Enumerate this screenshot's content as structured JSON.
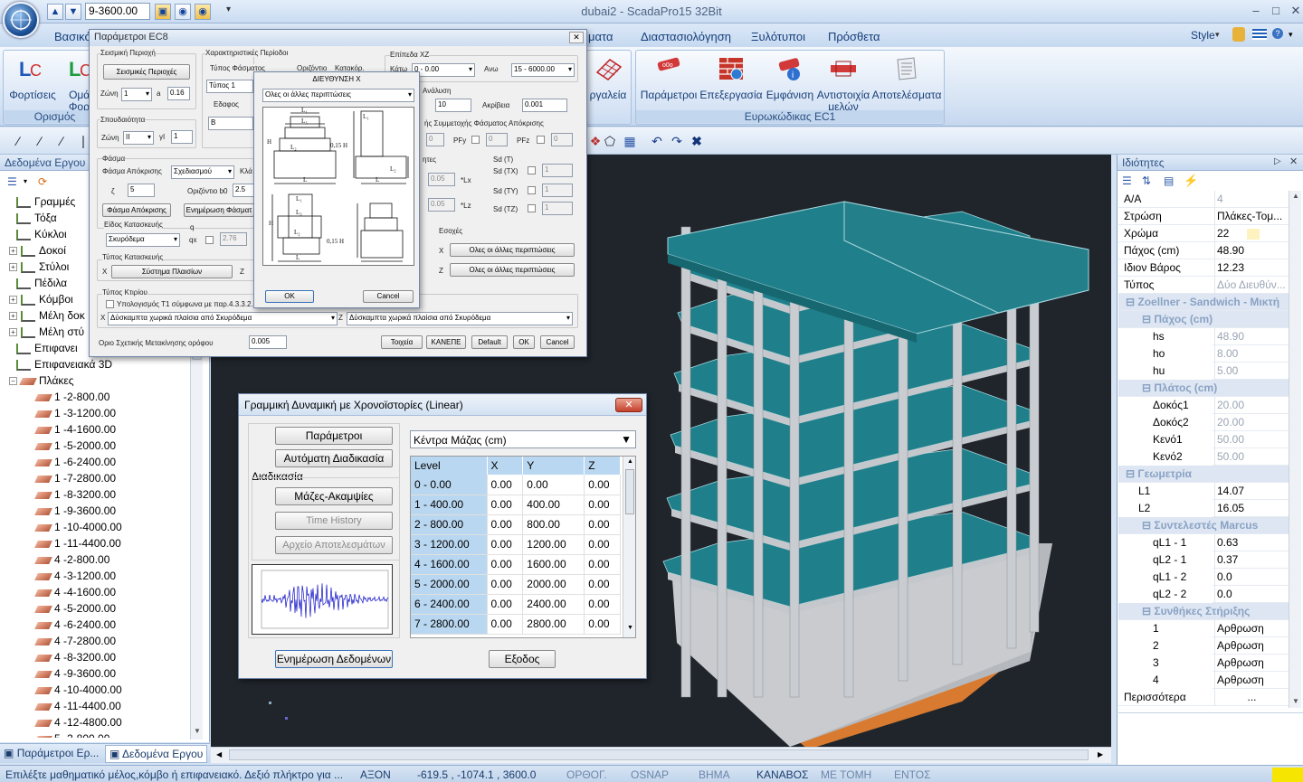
{
  "app": {
    "title": "dubai2 - ScadaPro15 32Bit",
    "level_select": "9-3600.00"
  },
  "menu_tabs": [
    "Βασικό",
    "ματα",
    "Διαστασιολόγηση",
    "Ξυλότυποι",
    "Πρόσθετα"
  ],
  "style_label": "Style",
  "ribbon": {
    "left_group": {
      "label": "Ορισμός",
      "buttons": [
        "Φορτίσεις",
        "Ομάδ Φορτί"
      ]
    },
    "tools_label": "ργαλεία",
    "ec1_group": {
      "label": "Ευρωκώδικας EC1",
      "buttons": [
        "Παράμετροι",
        "Επεξεργασία",
        "Εμφάνιση",
        "Αντιστοιχία μελών",
        "Αποτελέσματα"
      ]
    }
  },
  "left_panel": {
    "title": "Δεδομένα Εργου",
    "tree": [
      "Γραμμές",
      "Τόξα",
      "Κύκλοι",
      "Δοκοί",
      "Στύλοι",
      "Πέδιλα",
      "Κόμβοι",
      "Μέλη δοκ",
      "Μέλη στύ",
      "Επιφανει",
      "Επιφανειακά 3D",
      "Πλάκες",
      "1 -2-800.00",
      "1 -3-1200.00",
      "1 -4-1600.00",
      "1 -5-2000.00",
      "1 -6-2400.00",
      "1 -7-2800.00",
      "1 -8-3200.00",
      "1 -9-3600.00",
      "1 -10-4000.00",
      "1 -11-4400.00",
      "4 -2-800.00",
      "4 -3-1200.00",
      "4 -4-1600.00",
      "4 -5-2000.00",
      "4 -6-2400.00",
      "4 -7-2800.00",
      "4 -8-3200.00",
      "4 -9-3600.00",
      "4 -10-4000.00",
      "4 -11-4400.00",
      "4 -12-4800.00",
      "5 -2-800.00"
    ],
    "bottom_tabs": [
      "Παράμετροι Ερ...",
      "Δεδομένα Εργου"
    ]
  },
  "properties": {
    "title": "Ιδιότητες",
    "rows": [
      {
        "k": "A/A",
        "v": "4",
        "dis": true
      },
      {
        "k": "Στρώση",
        "v": "Πλάκες-Τομ..."
      },
      {
        "k": "Χρώμα",
        "v": "22"
      },
      {
        "k": "Πάχος (cm)",
        "v": "48.90"
      },
      {
        "k": "Ιδιον Βάρος",
        "v": "12.23"
      },
      {
        "k": "Τύπος",
        "v": "Δύο Διευθύν...",
        "dis": true
      },
      {
        "cat": "Zoellner - Sandwich - Μικτή"
      },
      {
        "sub": "Πάχος (cm)"
      },
      {
        "k": "hs",
        "v": "48.90",
        "ind": 2,
        "dis": true
      },
      {
        "k": "ho",
        "v": "8.00",
        "ind": 2,
        "dis": true
      },
      {
        "k": "hu",
        "v": "5.00",
        "ind": 2,
        "dis": true
      },
      {
        "sub": "Πλάτος (cm)"
      },
      {
        "k": "Δοκός1",
        "v": "20.00",
        "ind": 2,
        "dis": true
      },
      {
        "k": "Δοκός2",
        "v": "20.00",
        "ind": 2,
        "dis": true
      },
      {
        "k": "Κενό1",
        "v": "50.00",
        "ind": 2,
        "dis": true
      },
      {
        "k": "Κενό2",
        "v": "50.00",
        "ind": 2,
        "dis": true
      },
      {
        "cat": "Γεωμετρία"
      },
      {
        "k": "L1",
        "v": "14.07",
        "ind": 1
      },
      {
        "k": "L2",
        "v": "16.05",
        "ind": 1
      },
      {
        "sub": "Συντελεστές Marcus"
      },
      {
        "k": "qL1 - 1",
        "v": "0.63",
        "ind": 2
      },
      {
        "k": "qL2 - 1",
        "v": "0.37",
        "ind": 2
      },
      {
        "k": "qL1 - 2",
        "v": "0.0",
        "ind": 2
      },
      {
        "k": "qL2 - 2",
        "v": "0.0",
        "ind": 2
      },
      {
        "sub": "Συνθήκες Στήριξης"
      },
      {
        "k": "1",
        "v": "Αρθρωση",
        "ind": 2
      },
      {
        "k": "2",
        "v": "Αρθρωση",
        "ind": 2
      },
      {
        "k": "3",
        "v": "Αρθρωση",
        "ind": 2
      },
      {
        "k": "4",
        "v": "Αρθρωση",
        "ind": 2
      },
      {
        "k": "Περισσότερα",
        "v": "...",
        "ind": 0
      }
    ]
  },
  "status": {
    "hint": "Επιλέξτε μαθηματικό μέλος,κόμβο ή επιφανειακό. Δεξιό πλήκτρο για ...",
    "items": [
      "ΑΞΟΝ",
      "-619.5 , -1074.1 , 3600.0",
      "ΟΡΘΟΓ.",
      "OSNAP",
      "ΒΗΜΑ",
      "ΚΑΝΑΒΟΣ",
      "ΜΕ ΤΟΜΗ",
      "ΕΝΤΟΣ"
    ]
  },
  "ec8": {
    "title": "Παράμετροι EC8",
    "seismic_zone": "Σεισμική Περιοχή",
    "seismic_btn": "Σεισμικές Περιοχές",
    "zone_label": "Ζώνη",
    "zone_val": "1",
    "a_label": "a",
    "a_val": "0.16",
    "importance": "Σπουδαιότητα",
    "imp_zone_label": "Ζώνη",
    "imp_zone_val": "II",
    "gi_label": "γI",
    "gi_val": "1",
    "period": "Χαρακτηριστικές Περίοδοι",
    "spec_type_label": "Τύπος Φάσματος",
    "horiz_label": "Οριζόντιο",
    "vert_label": "Κατακόρ.",
    "type1": "Τύπος 1",
    "soil_label": "Εδαφος",
    "soil_val": "B",
    "spectrum": "Φάσμα",
    "resp_label": "Φάσμα Απόκρισης",
    "resp_val": "Σχεδιασμού",
    "class_label": "Κλά",
    "zeta_label": "ζ",
    "zeta_val": "5",
    "b0_label": "Οριζόντιο b0",
    "b0_val": "2.5",
    "resp_btn": "Φάσμα Απόκρισης",
    "update_btn": "Ενημέρωση Φάσματ",
    "constr_label": "Είδος Κατασκευής",
    "q_label": "q",
    "constr_val": "Σκυρόδεμα",
    "qx_label": "qx",
    "qx_val": "2.76",
    "constr_type": "Τύπος Κατασκευής",
    "x_label": "X",
    "x_system_btn": "Σύστημα Πλαισίων",
    "z_label": "Z",
    "building_type": "Τύπος Κτιρίου",
    "t1_check": "Υπολογισμός Τ1 σύμφωνα με παρ.4.3.3.2.",
    "x_dual": "Δύσκαμπτα χωρικά πλαίσια από Σκυρόδεμα",
    "z_dual": "Δύσκαμπτα χωρικά πλαίσια από Σκυρόδεμα",
    "drift_label": "Οριο Σχετικής Μετακίνησης ορόφου",
    "drift_val": "0.005",
    "xz_levels": "Επίπεδα XZ",
    "below_label": "Κάτω",
    "below_val": "0 - 0.00",
    "above_label": "Ανω",
    "above_val": "15 - 6000.00",
    "analysis": "Ανάλυση",
    "analysis_val": "10",
    "accuracy_label": "Ακρίβεια",
    "accuracy_val": "0.001",
    "participation": "ής Συμμετοχής Φάσματος Απόκρισης",
    "pfy": "PFy",
    "pfz": "PFz",
    "pf0": "0",
    "sd": "Sd (T)",
    "sdtx": "Sd (TX)",
    "sdty": "Sd (TY)",
    "sdtz": "Sd (TZ)",
    "sd1": "1",
    "ecc_label": "ητες",
    "ecc_val": "0.05",
    "lx": "*Lx",
    "lz": "*Lz",
    "eccentr": "Εσοχές",
    "ecc_x": "X",
    "ecc_z": "Z",
    "all_other": "Ολες οι άλλες περιπτώσεις",
    "btn_walls": "Τοιχεία",
    "btn_none": "ΚΑΝΕΠΕ",
    "btn_default": "Default",
    "btn_ok": "OK",
    "btn_cancel": "Cancel"
  },
  "dirx": {
    "title": "ΔΙΕΥΘΥΝΣΗ X",
    "select": "Ολες οι άλλες περιπτώσεις",
    "ok": "OK",
    "cancel": "Cancel",
    "fig_labels": [
      "L₁",
      "L₃",
      "L₂",
      "L",
      "H",
      "0,15 H",
      "L₁",
      "L₂",
      "L",
      "L₁",
      "L₃",
      "L₂",
      "0,15 H",
      "L",
      "H"
    ]
  },
  "lin": {
    "title": "Γραμμική Δυναμική με Χρονοϊστορίες (Linear)",
    "btn_params": "Παράμετροι",
    "btn_auto": "Αυτόματη Διαδικασία",
    "proc_label": "Διαδικασία",
    "btn_mass": "Μάζες-Ακαμψίες",
    "btn_th": "Time History",
    "btn_results": "Αρχείο Αποτελεσμάτων",
    "btn_update": "Ενημέρωση Δεδομένων",
    "btn_exit": "Εξοδος",
    "combo": "Κέντρα Μάζας (cm)",
    "headers": [
      "Level",
      "X",
      "Y",
      "Z"
    ],
    "rows": [
      [
        "0 - 0.00",
        "0.00",
        "0.00",
        "0.00"
      ],
      [
        "1 - 400.00",
        "0.00",
        "400.00",
        "0.00"
      ],
      [
        "2 - 800.00",
        "0.00",
        "800.00",
        "0.00"
      ],
      [
        "3 - 1200.00",
        "0.00",
        "1200.00",
        "0.00"
      ],
      [
        "4 - 1600.00",
        "0.00",
        "1600.00",
        "0.00"
      ],
      [
        "5 - 2000.00",
        "0.00",
        "2000.00",
        "0.00"
      ],
      [
        "6 - 2400.00",
        "0.00",
        "2400.00",
        "0.00"
      ],
      [
        "7 - 2800.00",
        "0.00",
        "2800.00",
        "0.00"
      ]
    ]
  }
}
